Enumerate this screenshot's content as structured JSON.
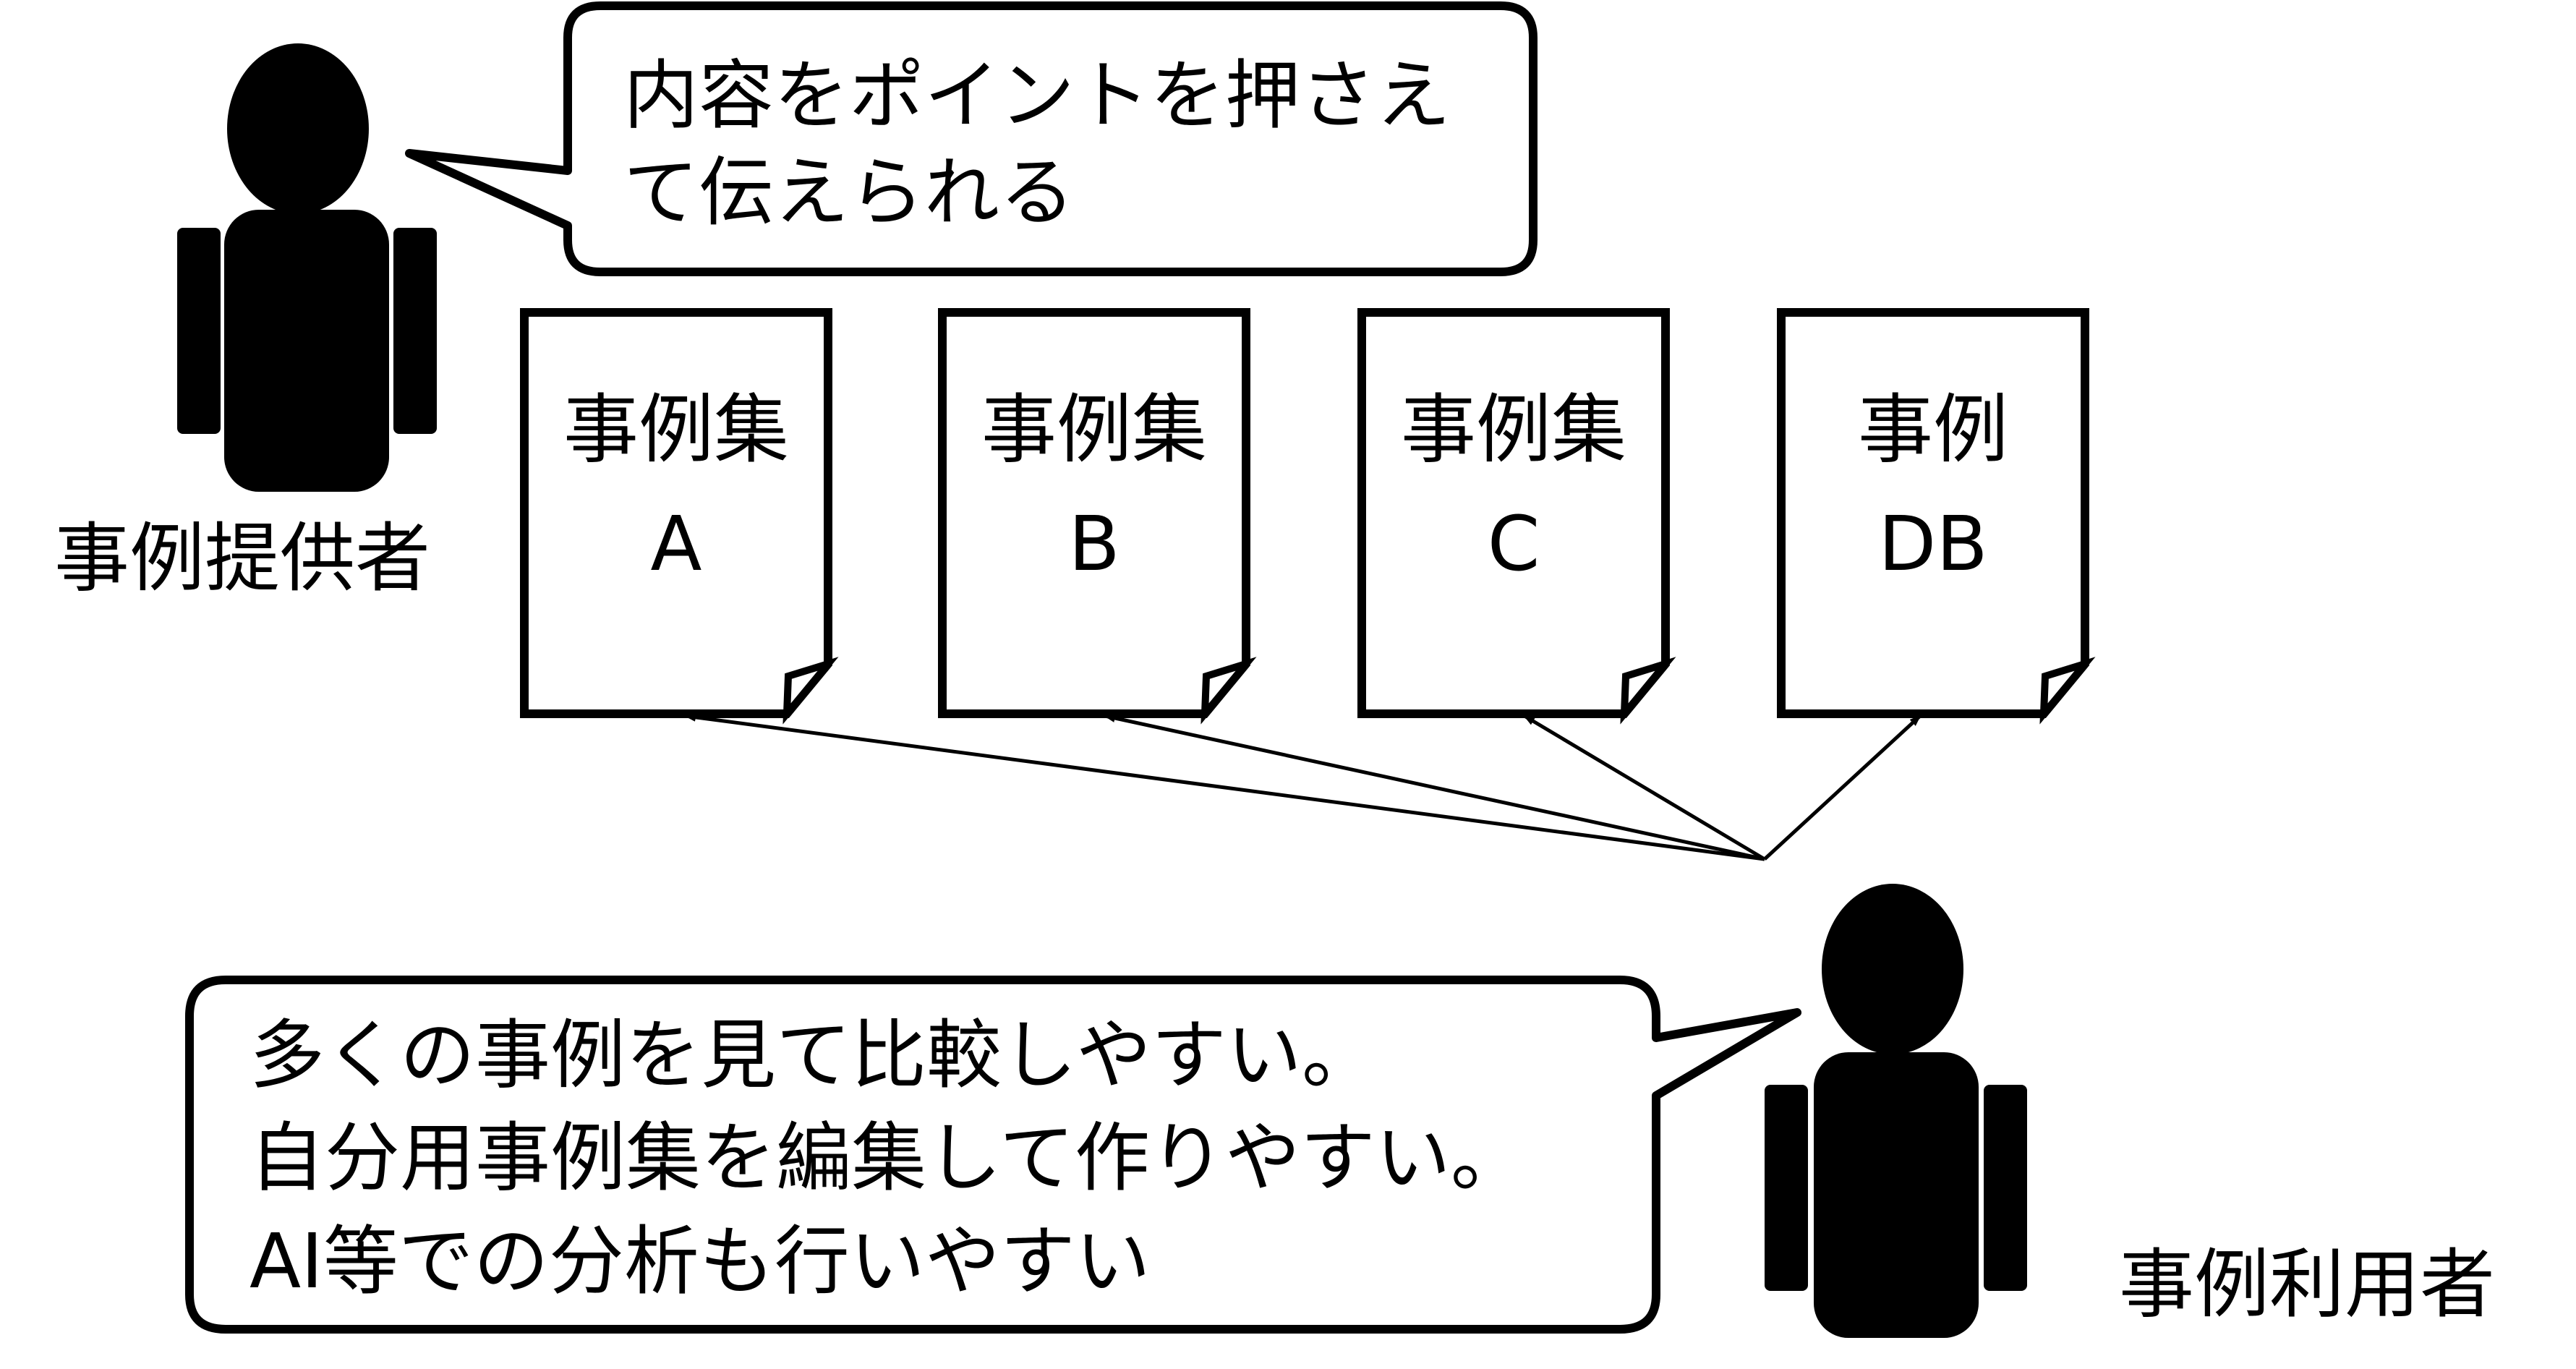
{
  "provider": {
    "label": "事例提供者",
    "speech_lines": [
      "内容をポイントを押さえ",
      "て伝えられる"
    ]
  },
  "user": {
    "label": "事例利用者",
    "speech_lines": [
      "多くの事例を見て比較しやすい。",
      "自分用事例集を編集して作りやすい。",
      "AI等での分析も行いやすい"
    ]
  },
  "documents": [
    {
      "title": "事例集",
      "subtitle": "A"
    },
    {
      "title": "事例集",
      "subtitle": "B"
    },
    {
      "title": "事例集",
      "subtitle": "C"
    },
    {
      "title": "事例",
      "subtitle": "DB"
    }
  ],
  "colors": {
    "ink": "#000000",
    "paper": "#ffffff"
  },
  "icons": {
    "person": "person-icon",
    "document": "document-icon",
    "arrow": "arrow-icon"
  }
}
